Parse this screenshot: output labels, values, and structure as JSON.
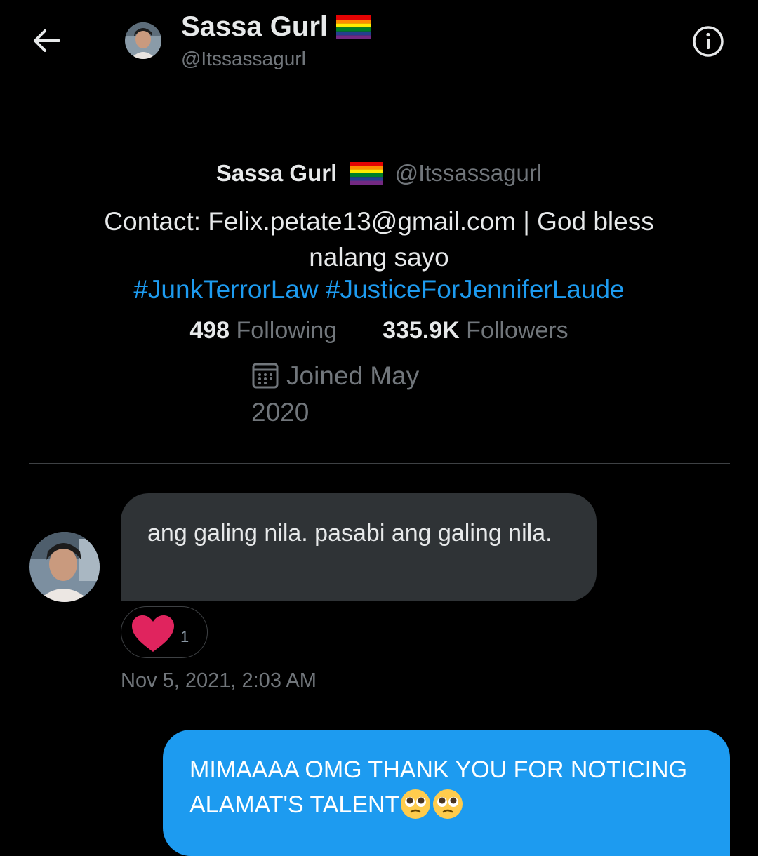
{
  "header": {
    "name": "Sassa Gurl",
    "handle": "@Itssassagurl"
  },
  "profile": {
    "name": "Sassa Gurl",
    "handle": "@Itssassagurl",
    "bio": "Contact: Felix.petate13@gmail.com | God bless nalang sayo",
    "hashtags": "#JunkTerrorLaw #JusticeForJenniferLaude",
    "following_count": "498",
    "following_label": "Following",
    "followers_count": "335.9K",
    "followers_label": "Followers",
    "joined_line1": "Joined May",
    "joined_line2": "2020"
  },
  "messages": {
    "incoming_text": "ang galing nila. pasabi ang galing nila.",
    "reaction_count": "1",
    "incoming_time": "Nov 5, 2021, 2:03 AM",
    "outgoing_text": "MIMAAAA OMG THANK YOU FOR NOTICING ALAMAT'S TALENT"
  },
  "icons": {
    "back": "arrow-left-icon",
    "info": "info-icon",
    "calendar": "calendar-icon",
    "heart": "heart-icon",
    "flag": "rainbow-flag-icon",
    "emoji": "pleading-face-emoji"
  },
  "colors": {
    "background": "#000000",
    "accent": "#1d9bf0",
    "bubble_incoming": "#2f3336",
    "secondary_text": "#71767b",
    "heart": "#e0245e"
  }
}
